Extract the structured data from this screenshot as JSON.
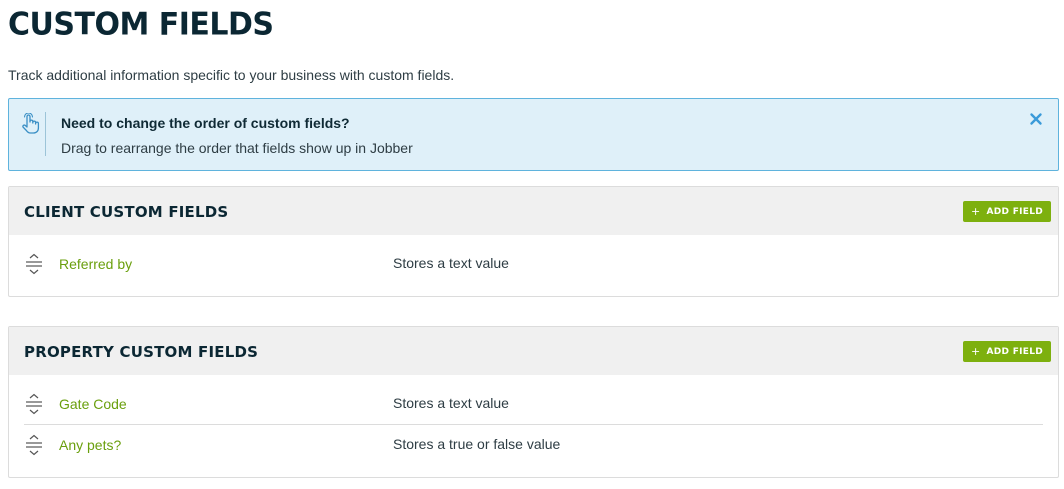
{
  "page": {
    "title": "CUSTOM FIELDS",
    "description": "Track additional information specific to your business with custom fields."
  },
  "banner": {
    "icon": "hand-pointer-icon",
    "title": "Need to change the order of custom fields?",
    "text": "Drag to rearrange the order that fields show up in Jobber",
    "close_icon": "close-icon",
    "colors": {
      "background": "#dff0f9",
      "border": "#5fb3dd",
      "close": "#3a9ad9"
    }
  },
  "client_section": {
    "title": "CLIENT CUSTOM FIELDS",
    "add_label": "ADD FIELD",
    "fields": [
      {
        "name": "Referred by",
        "type": "Stores a text value"
      }
    ]
  },
  "property_section": {
    "title": "PROPERTY CUSTOM FIELDS",
    "add_label": "ADD FIELD",
    "fields": [
      {
        "name": "Gate Code",
        "type": "Stores a text value"
      },
      {
        "name": "Any pets?",
        "type": "Stores a true or false value"
      }
    ]
  },
  "colors": {
    "accent": "#7db00e",
    "link": "#6a9f0d",
    "heading": "#0b2733"
  }
}
